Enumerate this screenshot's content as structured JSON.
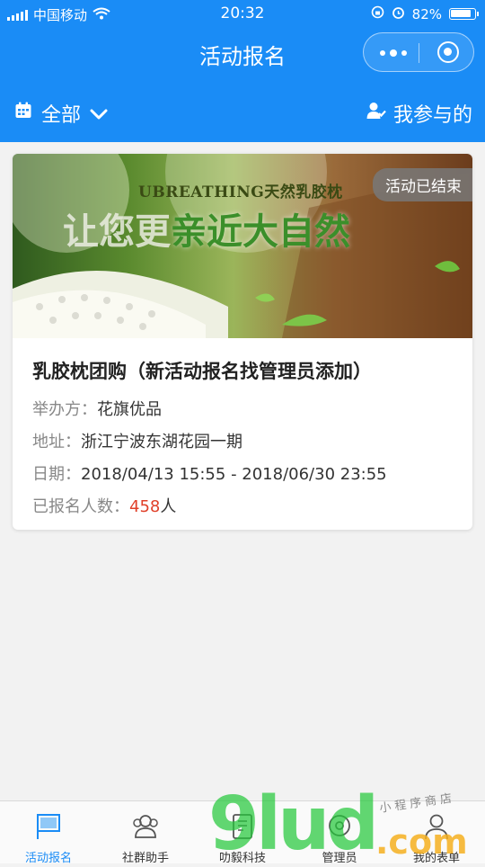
{
  "status_bar": {
    "carrier": "中国移动",
    "time": "20:32",
    "battery": "82%"
  },
  "nav": {
    "title": "活动报名"
  },
  "filter": {
    "all_label": "全部",
    "mine_label": "我参与的"
  },
  "activity": {
    "banner": {
      "brand": "UBREATHING天然乳胶枕",
      "slogan_light": "让您更",
      "slogan_green": "亲近大自然"
    },
    "status_badge": "活动已结束",
    "name": "乳胶枕团购（新活动报名找管理员添加）",
    "organizer_label": "举办方：",
    "organizer": "花旗优品",
    "address_label": "地址：",
    "address": "浙江宁波东湖花园一期",
    "date_label": "日期：",
    "date": "2018/04/13 15:55 - 2018/06/30 23:55",
    "signup_label": "已报名人数：",
    "signup_count": "458",
    "signup_unit": "人"
  },
  "tabs": [
    {
      "label": "活动报名",
      "icon": "flag-icon",
      "active": true
    },
    {
      "label": "社群助手",
      "icon": "group-icon",
      "active": false
    },
    {
      "label": "叻毅科技",
      "icon": "book-icon",
      "active": false
    },
    {
      "label": "管理员",
      "icon": "admin-icon",
      "active": false
    },
    {
      "label": "我的表单",
      "icon": "user-icon",
      "active": false
    }
  ],
  "watermark": {
    "big": "9lud",
    "com": ".com",
    "small": "小程序商店"
  },
  "colors": {
    "brand_blue": "#1a8cf6",
    "count_red": "#e0402a",
    "badge_gray": "#787878"
  }
}
